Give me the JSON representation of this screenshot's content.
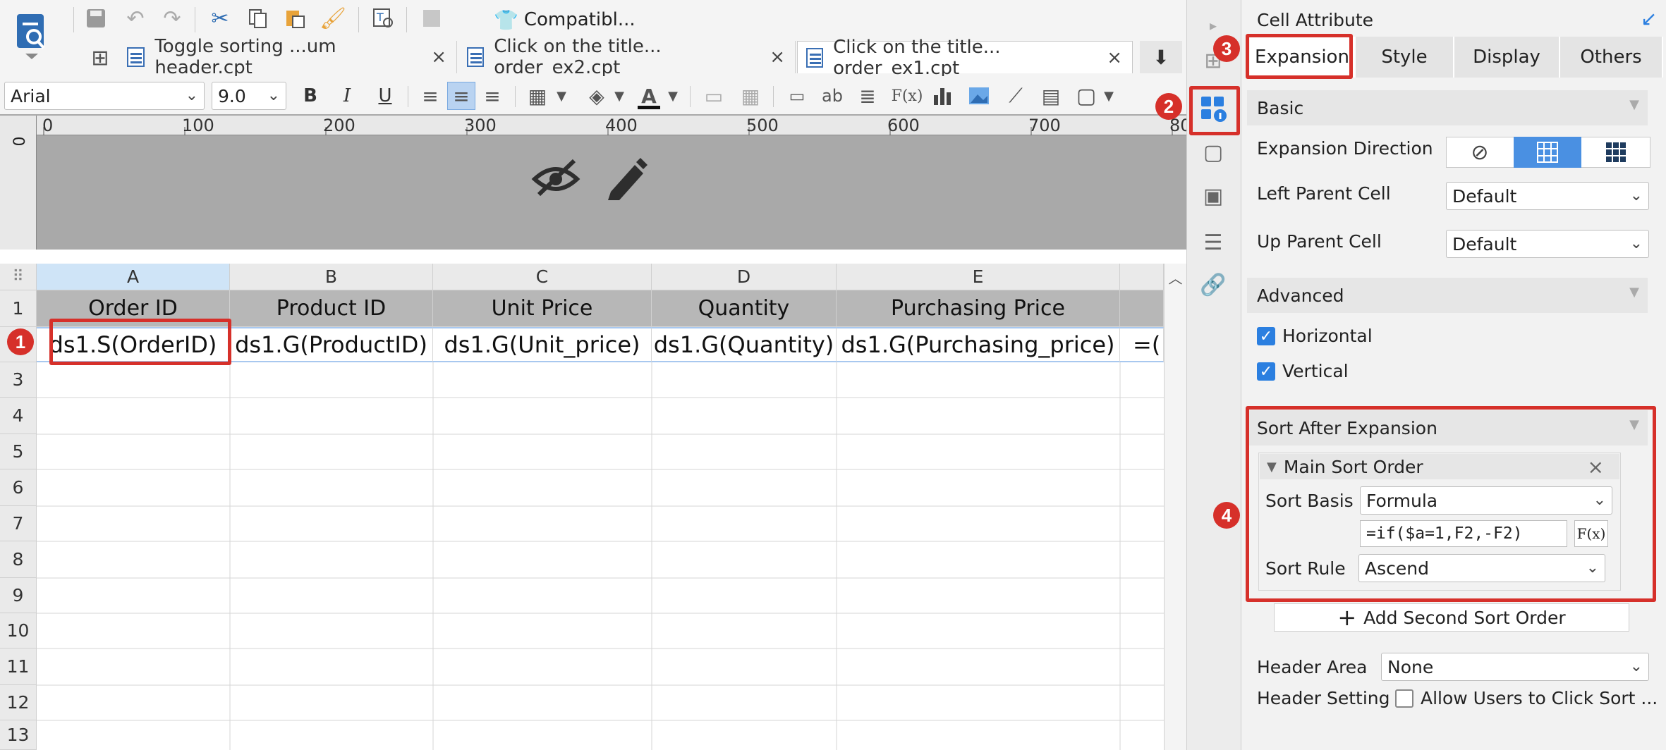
{
  "toolbar": {
    "compat_label": "Compatibl...",
    "font_name": "Arial",
    "font_size": "9.0",
    "bold": "B",
    "italic": "I",
    "underline": "U",
    "text_ab": "ab",
    "fx": "F(x)"
  },
  "tabs": [
    {
      "label": "Toggle sorting ...um header.cpt",
      "close": "×"
    },
    {
      "label": "Click on the title... order_ex2.cpt",
      "close": "×"
    },
    {
      "label": "Click on the title... order_ex1.cpt",
      "close": "×"
    }
  ],
  "ruler": {
    "ticks": [
      "0",
      "100",
      "200",
      "300",
      "400",
      "500",
      "600",
      "700",
      "80"
    ],
    "vzero": "0"
  },
  "sheet": {
    "corner": "⠿",
    "columns": [
      "A",
      "B",
      "C",
      "D",
      "E"
    ],
    "rows": [
      "1",
      "2",
      "3",
      "4",
      "5",
      "6",
      "7",
      "8",
      "9",
      "10",
      "11",
      "12",
      "13"
    ],
    "header_row": [
      "Order ID",
      "Product ID",
      "Unit Price",
      "Quantity",
      "Purchasing Price"
    ],
    "data_row": [
      "ds1.S(OrderID)",
      "ds1.G(ProductID)",
      "ds1.G(Unit_price)",
      "ds1.G(Quantity)",
      "ds1.G(Purchasing_price)",
      "=("
    ]
  },
  "badges": [
    "1",
    "2",
    "3",
    "4"
  ],
  "panel": {
    "title": "Cell Attribute",
    "tabs": [
      "Expansion",
      "Style",
      "Display",
      "Others"
    ],
    "basic": "Basic",
    "expansion_direction": "Expansion Direction",
    "left_parent_label": "Left Parent Cell",
    "left_parent_value": "Default",
    "up_parent_label": "Up Parent Cell",
    "up_parent_value": "Default",
    "advanced": "Advanced",
    "horizontal": "Horizontal",
    "vertical": "Vertical",
    "sort_after": "Sort After Expansion",
    "main_sort": "Main Sort Order",
    "sort_basis_label": "Sort Basis",
    "sort_basis_value": "Formula",
    "formula": "=if($a=1,F2,-F2)",
    "sort_rule_label": "Sort Rule",
    "sort_rule_value": "Ascend",
    "add_second": "Add Second Sort Order",
    "header_area_label": "Header Area",
    "header_area_value": "None",
    "header_setting_label": "Header Setting",
    "allow_click_sort": "Allow Users to Click Sort ..."
  },
  "colors": {
    "accent": "#d6302a",
    "selected_blue": "#4a90e2"
  }
}
